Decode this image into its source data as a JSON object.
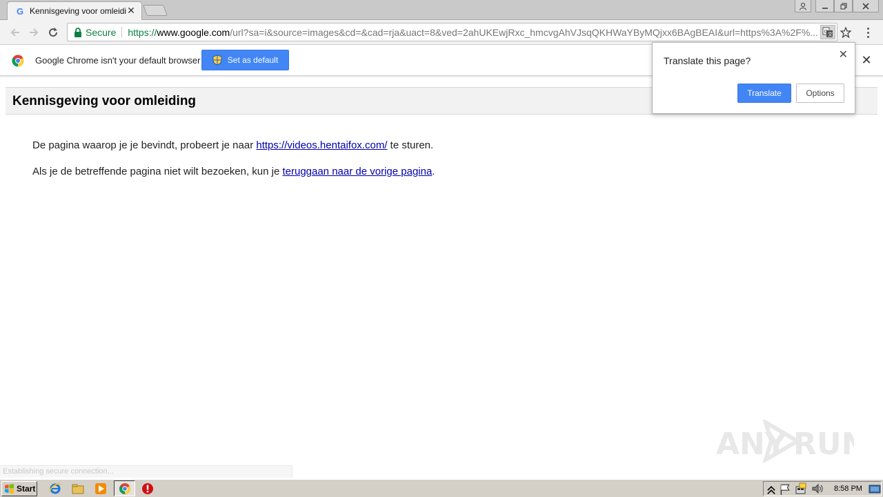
{
  "browser": {
    "tab": {
      "title": "Kennisgeving voor omleiding"
    },
    "omnibox": {
      "secure_label": "Secure",
      "url_scheme": "https://",
      "url_host": "www.google.com",
      "url_rest": "/url?sa=i&source=images&cd=&cad=rja&uact=8&ved=2ahUKEwjRxc_hmcvgAhVJsqQKHWaYByMQjxx6BAgBEAI&url=https%3A%2F%..."
    },
    "infobar": {
      "message": "Google Chrome isn't your default browser",
      "set_default_label": "Set as default"
    },
    "translate_bubble": {
      "title": "Translate this page?",
      "translate_label": "Translate",
      "options_label": "Options"
    },
    "status_text": "Establishing secure connection..."
  },
  "page": {
    "title": "Kennisgeving voor omleiding",
    "line1_before": "De pagina waarop je je bevindt, probeert je naar ",
    "line1_link": "https://videos.hentaifox.com/",
    "line1_after": " te sturen.",
    "line2_before": "Als je de betreffende pagina niet wilt bezoeken, kun je ",
    "line2_link": "teruggaan naar de vorige pagina",
    "line2_after": "."
  },
  "watermark": {
    "text_left": "ANY",
    "text_right": "RUN"
  },
  "taskbar": {
    "start_label": "Start",
    "clock": "8:58 PM",
    "pinned_icons": [
      "ie-icon",
      "explorer-folder-icon",
      "media-player-icon",
      "chrome-icon",
      "antivirus-icon"
    ]
  },
  "colors": {
    "accent_blue": "#4285f4",
    "secure_green": "#0b8043",
    "link_blue": "#0000aa"
  }
}
